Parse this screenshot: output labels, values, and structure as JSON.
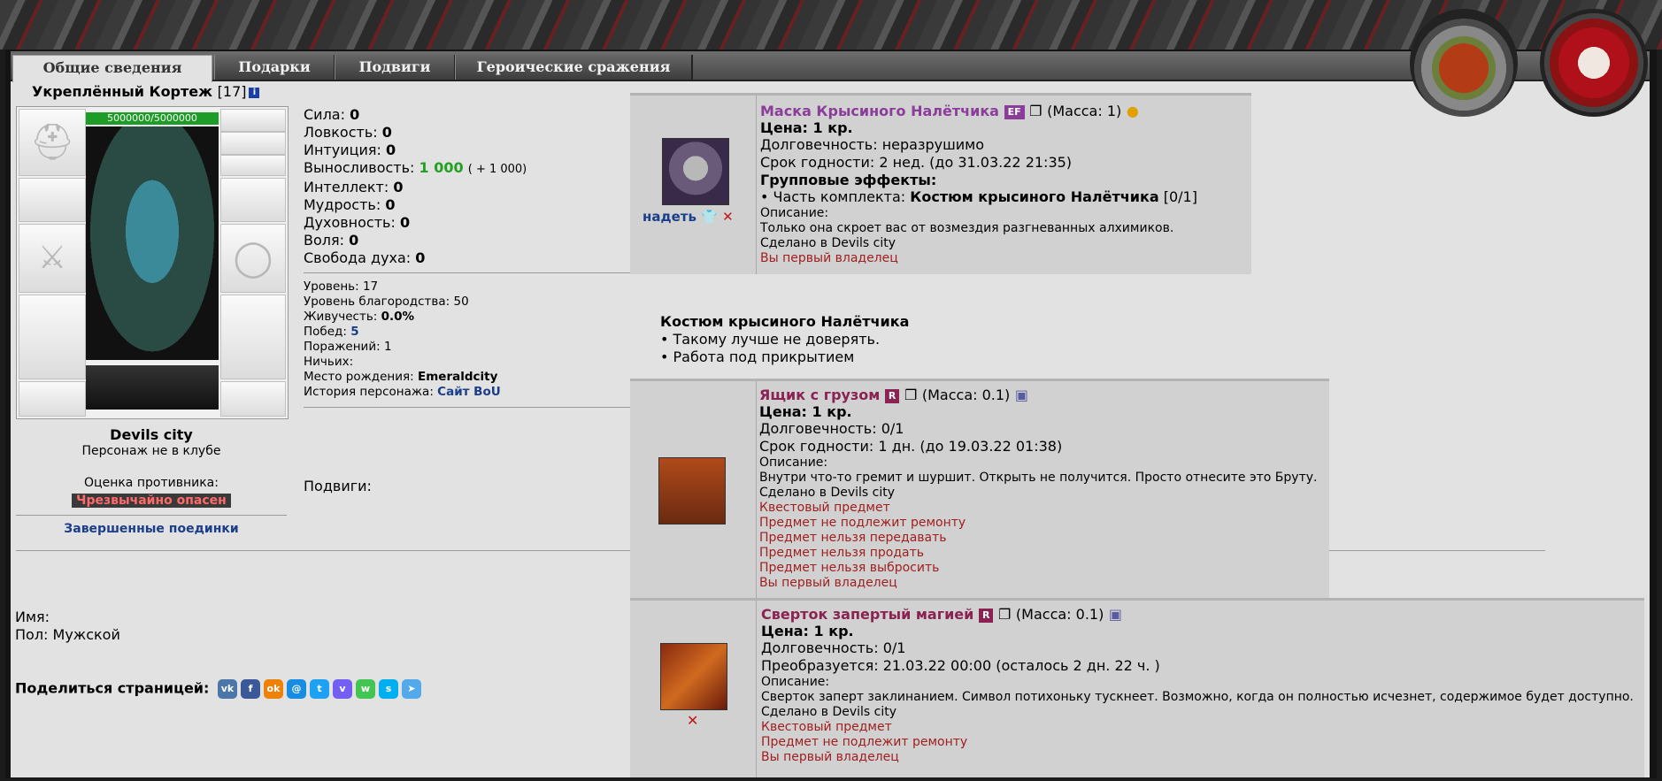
{
  "tabs": [
    "Общие сведения",
    "Подарки",
    "Подвиги",
    "Героические сражения"
  ],
  "character": {
    "name": "Укреплённый Кортеж",
    "level": "[17]",
    "hp": "5000000/5000000",
    "city": "Devils city",
    "club": "Персонаж не в клубе",
    "threat_label": "Оценка противника:",
    "threat_value": "Чрезвычайно опасен",
    "finished_fights": "Завершенные поединки"
  },
  "stats": [
    {
      "label": "Сила:",
      "value": "0"
    },
    {
      "label": "Ловкость:",
      "value": "0"
    },
    {
      "label": "Интуиция:",
      "value": "0"
    },
    {
      "label": "Выносливость:",
      "value": "1 000",
      "extra": "( + 1 000)"
    },
    {
      "label": "Интеллект:",
      "value": "0"
    },
    {
      "label": "Мудрость:",
      "value": "0"
    },
    {
      "label": "Духовность:",
      "value": "0"
    },
    {
      "label": "Воля:",
      "value": "0"
    },
    {
      "label": "Свобода духа:",
      "value": "0"
    }
  ],
  "details": [
    {
      "label": "Уровень:",
      "value": "17"
    },
    {
      "label": "Уровень благородства:",
      "value": "50"
    },
    {
      "label": "Живучесть:",
      "value": "0.0%"
    },
    {
      "label": "Побед:",
      "value": "5"
    },
    {
      "label": "Поражений:",
      "value": "1"
    },
    {
      "label": "Ничьих:",
      "value": ""
    },
    {
      "label": "Место рождения:",
      "value": "Emeraldcity"
    },
    {
      "label": "История персонажа:",
      "value": "Сайт BoU"
    }
  ],
  "feats_label": "Подвиги:",
  "profile": {
    "name_label": "Имя:",
    "gender": "Пол: Мужской"
  },
  "share": {
    "label": "Поделиться страницей:",
    "icons": [
      {
        "name": "vk-icon",
        "glyph": "vk",
        "color": "#4a76a8"
      },
      {
        "name": "facebook-icon",
        "glyph": "f",
        "color": "#3b5998"
      },
      {
        "name": "odnoklassniki-icon",
        "glyph": "ok",
        "color": "#ee8208"
      },
      {
        "name": "mailru-icon",
        "glyph": "@",
        "color": "#168de2"
      },
      {
        "name": "twitter-icon",
        "glyph": "t",
        "color": "#1da1f2"
      },
      {
        "name": "viber-icon",
        "glyph": "v",
        "color": "#7360f2"
      },
      {
        "name": "whatsapp-icon",
        "glyph": "w",
        "color": "#43c553"
      },
      {
        "name": "skype-icon",
        "glyph": "s",
        "color": "#00aff0"
      },
      {
        "name": "telegram-icon",
        "glyph": "➤",
        "color": "#54a9eb"
      }
    ]
  },
  "item1": {
    "title": "Маска Крысиного Налётчика",
    "badge": "EF",
    "mass": "(Масса: 1)",
    "price": "Цена: 1 кр.",
    "durability": "Долговечность: неразрушимо",
    "expiry": "Срок годности: 2 нед. (до 31.03.22 21:35)",
    "group_title": "Групповые эффекты:",
    "set_prefix": "• Часть комплекта:",
    "set_name": "Костюм крысиного Налётчика",
    "set_count": "[0/1]",
    "desc_label": "Описание:",
    "desc": "Только она скроет вас от возмездия разгневанных алхимиков.",
    "made": "Сделано в Devils city",
    "owner": "Вы первый владелец",
    "wear": "надеть"
  },
  "set_info": {
    "title": "Костюм крысиного Налётчика",
    "line1": "• Такому лучше не доверять.",
    "line2": "• Работа под прикрытием"
  },
  "item2": {
    "title": "Ящик с грузом",
    "badge": "R",
    "mass": "(Масса: 0.1)",
    "price": "Цена: 1 кр.",
    "durability": "Долговечность: 0/1",
    "expiry": "Срок годности: 1 дн. (до 19.03.22 01:38)",
    "desc_label": "Описание:",
    "desc": "Внутри что-то гремит и шуршит. Открыть не получится. Просто отнесите это Бруту.",
    "made": "Сделано в Devils city",
    "flags": [
      "Квестовый предмет",
      "Предмет не подлежит ремонту",
      "Предмет нельзя передавать",
      "Предмет нельзя продать",
      "Предмет нельзя выбросить",
      "Вы первый владелец"
    ]
  },
  "item3": {
    "title": "Сверток запертый магией",
    "badge": "R",
    "mass": "(Масса: 0.1)",
    "price": "Цена: 1 кр.",
    "durability": "Долговечность: 0/1",
    "transform": "Преобразуется: 21.03.22 00:00 (осталось 2 дн. 22 ч. )",
    "desc_label": "Описание:",
    "desc": "Сверток заперт заклинанием. Символ потихоньку тускнеет. Возможно, когда он полностью исчезнет, содержимое будет доступно.",
    "made": "Сделано в Devils city",
    "flags": [
      "Квестовый предмет",
      "Предмет не подлежит ремонту",
      "Вы первый владелец"
    ]
  }
}
